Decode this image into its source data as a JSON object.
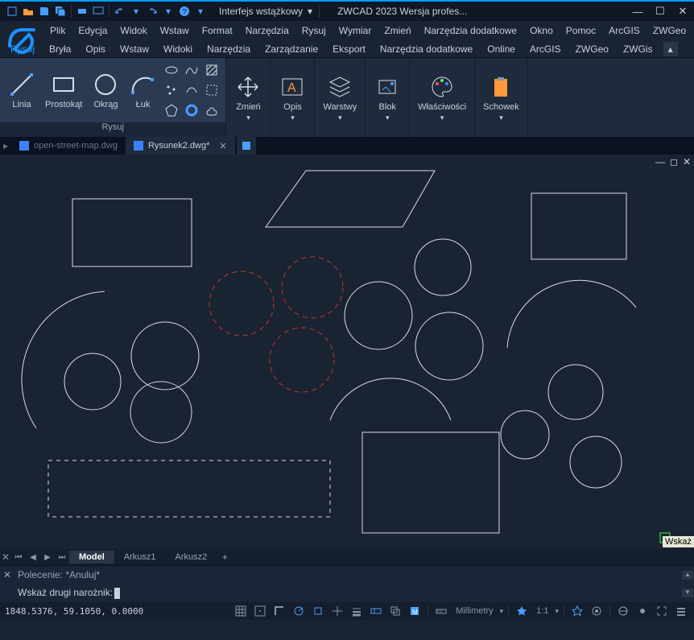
{
  "titlebar": {
    "interface_label": "Interfejs wstążkowy",
    "app_title": "ZWCAD 2023 Wersja profes..."
  },
  "menu": [
    "Plik",
    "Edycja",
    "Widok",
    "Wstaw",
    "Format",
    "Narzędzia",
    "Rysuj",
    "Wymiar",
    "Zmień",
    "Narzędzia dodatkowe",
    "Okno",
    "Pomoc",
    "ArcGIS",
    "ZWGeo"
  ],
  "tabs": [
    "Rysuj",
    "Bryła",
    "Opis",
    "Wstaw",
    "Widoki",
    "Narzędzia",
    "Zarządzanie",
    "Eksport",
    "Narzędzia dodatkowe",
    "Online",
    "ArcGIS",
    "ZWGeo",
    "ZWGis"
  ],
  "active_tab": "Rysuj",
  "ribbon": {
    "draw": {
      "label": "Rysuj",
      "linia": "Linia",
      "prostokat": "Prostokąt",
      "okrag": "Okrąg",
      "luk": "Łuk"
    },
    "zmien": "Zmień",
    "opis": "Opis",
    "warstwy": "Warstwy",
    "blok": "Blok",
    "wlasciwosci": "Właściwości",
    "schowek": "Schowek"
  },
  "doc_tabs": {
    "inactive": "open-street-map.dwg",
    "active": "Rysunek2.dwg*"
  },
  "canvas_tooltip": "Wskaż",
  "layout_tabs": {
    "model": "Model",
    "ark1": "Arkusz1",
    "ark2": "Arkusz2"
  },
  "cmd": {
    "history": "Polecenie: *Anuluj*",
    "prompt": "Wskaż drugi narożnik:"
  },
  "status": {
    "coords": "1848.5376, 59.1050, 0.0000",
    "units": "Millimetry",
    "scale": "1:1"
  },
  "colors": {
    "accent": "#00a0ff",
    "bg": "#1a2332",
    "stroke_white": "#d8dde5",
    "stroke_red": "#c0392b"
  },
  "chart_data": null
}
